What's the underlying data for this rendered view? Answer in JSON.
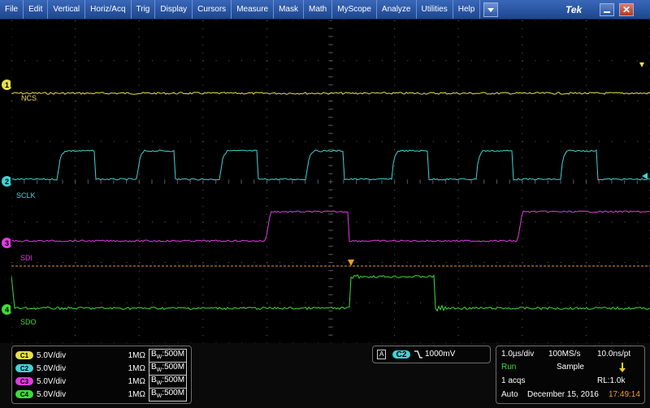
{
  "menu": {
    "items": [
      "File",
      "Edit",
      "Vertical",
      "Horiz/Acq",
      "Trig",
      "Display",
      "Cursors",
      "Measure",
      "Mask",
      "Math",
      "MyScope",
      "Analyze",
      "Utilities",
      "Help"
    ],
    "brand": "Tek"
  },
  "channels": [
    {
      "number": "1",
      "name": "NCS",
      "color": "#e6e14a",
      "scale": "5.0V/div",
      "coupling": "1MΩ",
      "bw": "500M",
      "badge": "C1"
    },
    {
      "number": "2",
      "name": "SCLK",
      "color": "#3fd3d6",
      "scale": "5.0V/div",
      "coupling": "1MΩ",
      "bw": "500M",
      "badge": "C2"
    },
    {
      "number": "3",
      "name": "SDI",
      "color": "#e03ce0",
      "scale": "5.0V/div",
      "coupling": "1MΩ",
      "bw": "500M",
      "badge": "C3"
    },
    {
      "number": "4",
      "name": "SDO",
      "color": "#3fdc3a",
      "scale": "5.0V/div",
      "coupling": "1MΩ",
      "bw": "500M",
      "badge": "C4"
    }
  ],
  "trigger": {
    "mode_badge": "A",
    "source": "C2",
    "level": "1000mV"
  },
  "horizontal": {
    "time_per_div": "1.0µs/div",
    "sample_rate": "100MS/s",
    "resolution": "10.0ns/pt",
    "state": "Run",
    "acq_mode": "Sample",
    "acqs": "1 acqs",
    "record_length": "RL:1.0k",
    "trigger_mode": "Auto",
    "date": "December 15, 2016",
    "time": "17:49:14"
  },
  "colors": {
    "trigger_line": "#e39a2c",
    "run": "#3fdc3a",
    "time": "#f0a020"
  }
}
